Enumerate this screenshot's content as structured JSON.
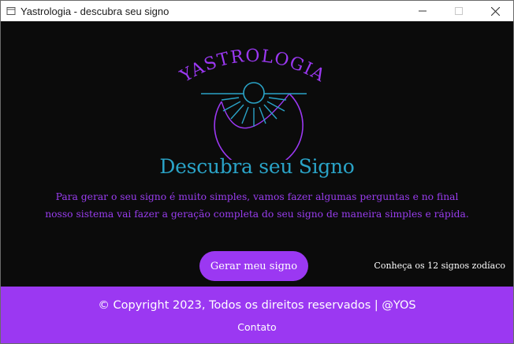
{
  "window": {
    "title": "Yastrologia - descubra seu signo",
    "controls": [
      "minimize-icon",
      "maximize-icon",
      "close-icon"
    ]
  },
  "logo": {
    "brand_text": "YASTROLOGIA",
    "icon": "sun-over-crescent-moon-icon",
    "colors": {
      "brand": "#9b38f2",
      "accent": "#2aa3c7"
    }
  },
  "main": {
    "headline": "Descubra seu Signo",
    "intro_line1": "Para gerar o seu signo é muito simples, vamos fazer algumas perguntas e no final",
    "intro_line2": "nosso sistema vai fazer a geração completa do seu signo de maneira simples e rápida.",
    "cta_label": "Gerar meu signo",
    "signs_link": "Conheça os 12 signos zodíaco"
  },
  "footer": {
    "copyright": "© Copyright 2023, Todos os direitos reservados | @YOS",
    "contact": "Contato",
    "background": "#9b38f2"
  }
}
